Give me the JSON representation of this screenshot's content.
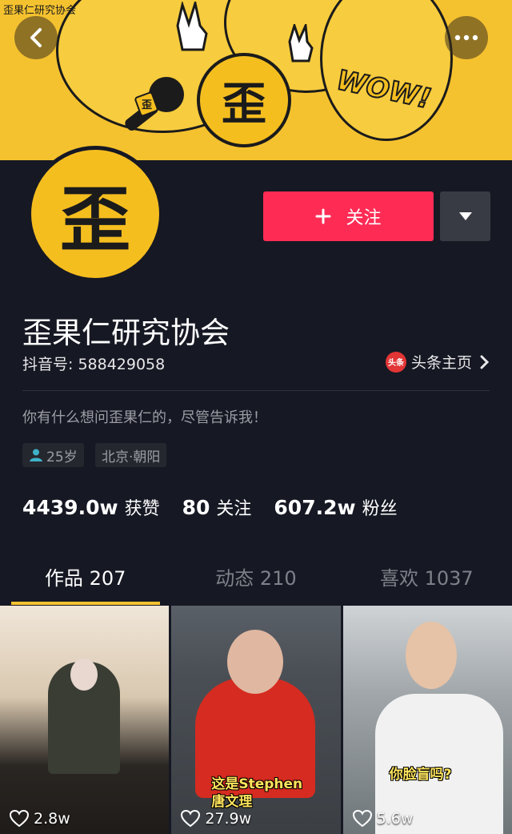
{
  "status_caption": "歪果仁研究协会",
  "banner": {
    "badge_char": "歪",
    "wow_text": "WOW!",
    "mic_char": "歪"
  },
  "profile": {
    "avatar_char": "歪",
    "name": "歪果仁研究协会",
    "douyin_id": "抖音号: 588429058",
    "toutiao_label": "头条主页",
    "toutiao_badge": "头条",
    "bio": "你有什么想问歪果仁的，尽管告诉我！",
    "tags": [
      "25岁",
      "北京·朝阳"
    ]
  },
  "follow_button": {
    "icon": "plus-icon",
    "label": "关注"
  },
  "stats": [
    {
      "value": "4439.0w",
      "label": "获赞"
    },
    {
      "value": "80",
      "label": "关注"
    },
    {
      "value": "607.2w",
      "label": "粉丝"
    }
  ],
  "tabs": [
    {
      "label": "作品 207",
      "active": true
    },
    {
      "label": "动态 210",
      "active": false
    },
    {
      "label": "喜欢 1037",
      "active": false
    }
  ],
  "videos": [
    {
      "likes": "2.8w",
      "subtitle": ""
    },
    {
      "likes": "27.9w",
      "subtitle": "这是Stephen 唐文理"
    },
    {
      "likes": "5.6w",
      "subtitle": "你脸盲吗?"
    }
  ],
  "colors": {
    "accent": "#fe2c55",
    "brand_yellow": "#f5c22f",
    "background": "#161823"
  }
}
